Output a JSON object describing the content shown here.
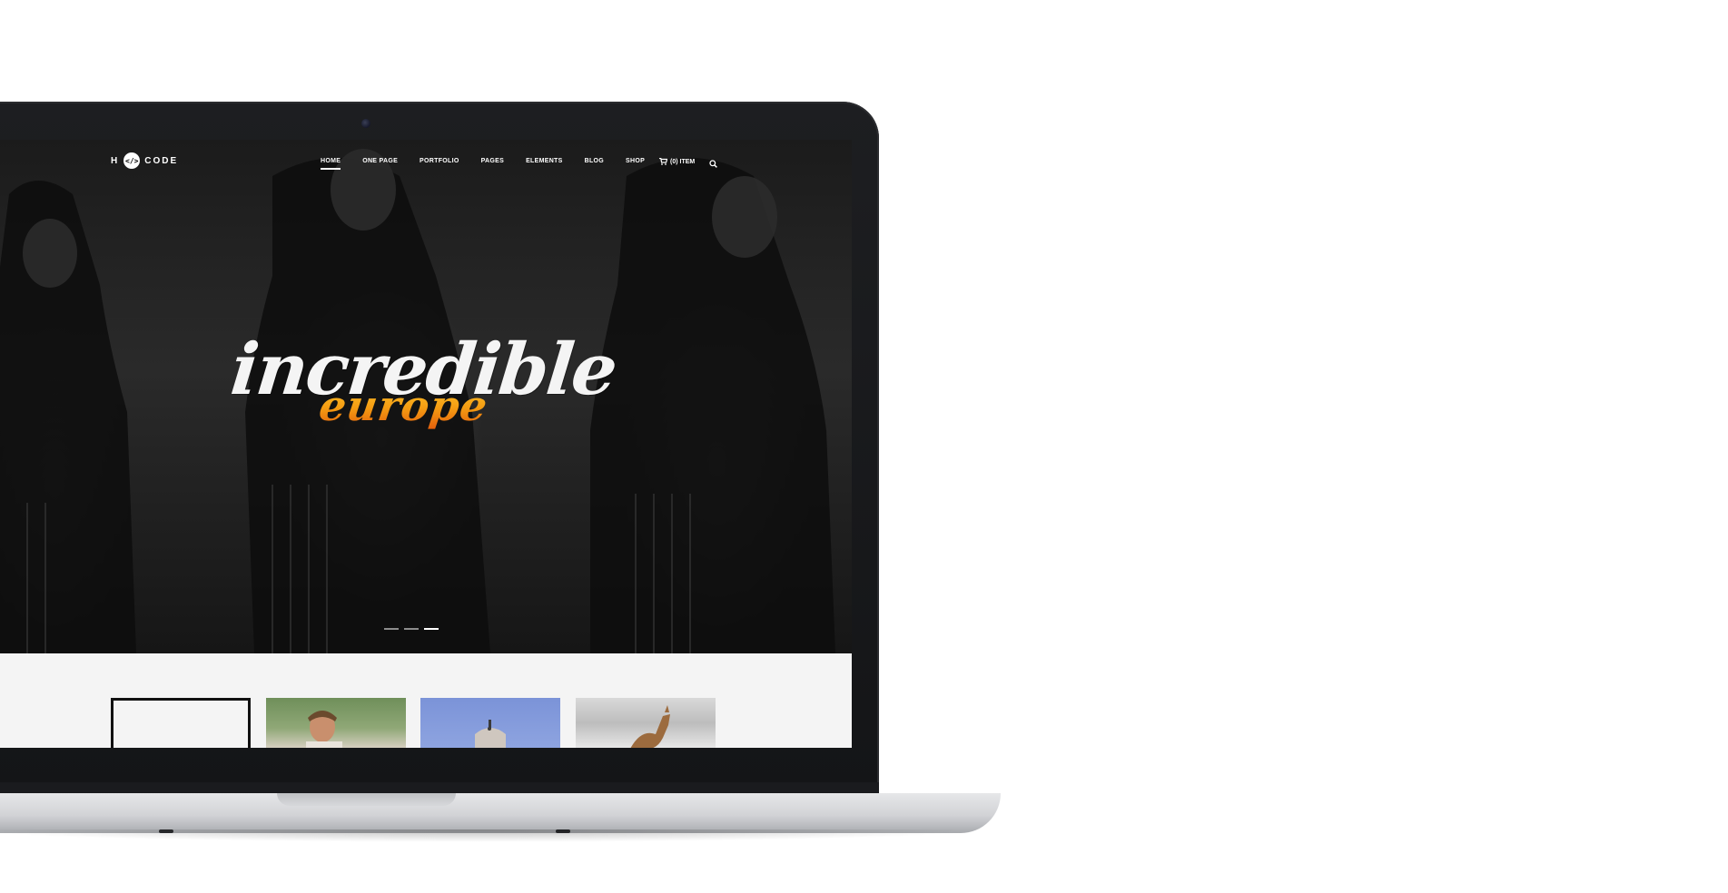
{
  "logo": {
    "left": "H",
    "badge": "</>",
    "right": "CODE"
  },
  "nav": {
    "items": [
      {
        "label": "HOME",
        "active": true
      },
      {
        "label": "ONE PAGE",
        "active": false
      },
      {
        "label": "PORTFOLIO",
        "active": false
      },
      {
        "label": "PAGES",
        "active": false
      },
      {
        "label": "ELEMENTS",
        "active": false
      },
      {
        "label": "BLOG",
        "active": false
      },
      {
        "label": "SHOP",
        "active": false
      }
    ],
    "cart": "(0) ITEM"
  },
  "hero": {
    "headline_line1": "incredible",
    "headline_line2": "europe",
    "slides_total": 3,
    "active_slide": 3
  },
  "colors": {
    "accent": "#f49b12",
    "hero_bg": "#1b1b1b",
    "band_bg": "#f4f4f4"
  },
  "icons": [
    "cart-icon",
    "search-icon",
    "camera-icon"
  ]
}
